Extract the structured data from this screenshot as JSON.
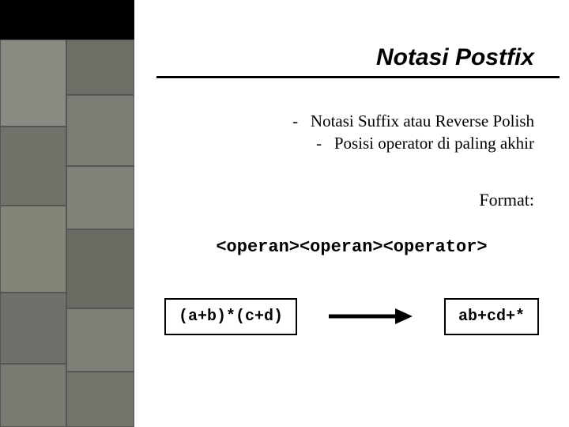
{
  "title": "Notasi Postfix",
  "bullets": {
    "line1": "-   Notasi Suffix atau Reverse Polish",
    "line2": "-   Posisi operator di paling akhir"
  },
  "format_label": "Format:",
  "format_expression": "<operan><operan><operator>",
  "example": {
    "input": "(a+b)*(c+d)",
    "output": "ab+cd+*"
  }
}
